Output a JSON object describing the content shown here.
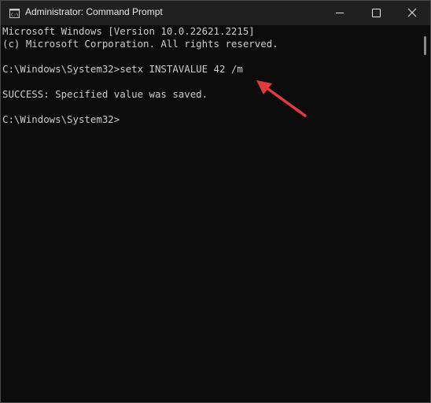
{
  "window": {
    "title": "Administrator: Command Prompt",
    "icon": "cmd-icon",
    "controls": [
      "minimize-icon",
      "maximize-icon",
      "close-icon"
    ]
  },
  "console": {
    "lines": [
      "Microsoft Windows [Version 10.0.22621.2215]",
      "(c) Microsoft Corporation. All rights reserved.",
      "",
      "C:\\Windows\\System32>setx INSTAVALUE 42 /m",
      "",
      "SUCCESS: Specified value was saved.",
      "",
      "C:\\Windows\\System32>"
    ]
  },
  "annotation": {
    "arrow_color": "#e03c3c"
  },
  "colors": {
    "background": "#0c0c0c",
    "titlebar": "#202020",
    "text": "#cccccc"
  }
}
